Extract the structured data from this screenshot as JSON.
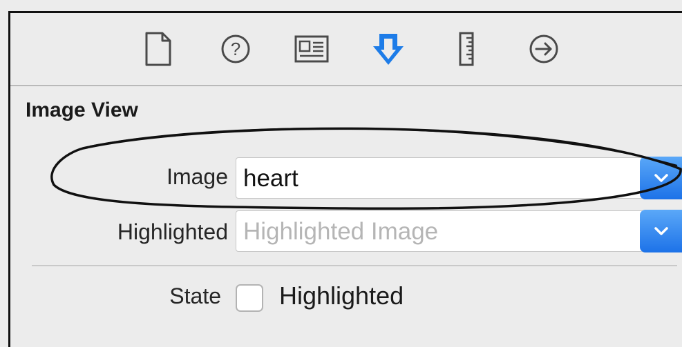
{
  "toolbar": {
    "icons": [
      {
        "name": "file-inspector-icon",
        "selected": false
      },
      {
        "name": "quick-help-icon",
        "selected": false
      },
      {
        "name": "identity-inspector-icon",
        "selected": false
      },
      {
        "name": "attributes-inspector-icon",
        "selected": true
      },
      {
        "name": "size-inspector-icon",
        "selected": false
      },
      {
        "name": "connections-inspector-icon",
        "selected": false
      }
    ],
    "accent_color": "#1d7ce8"
  },
  "section": {
    "title": "Image View"
  },
  "fields": {
    "image": {
      "label": "Image",
      "value": "heart"
    },
    "highlighted": {
      "label": "Highlighted",
      "value": "",
      "placeholder": "Highlighted Image"
    },
    "state": {
      "label": "State",
      "checkbox_label": "Highlighted",
      "checked": false
    }
  }
}
